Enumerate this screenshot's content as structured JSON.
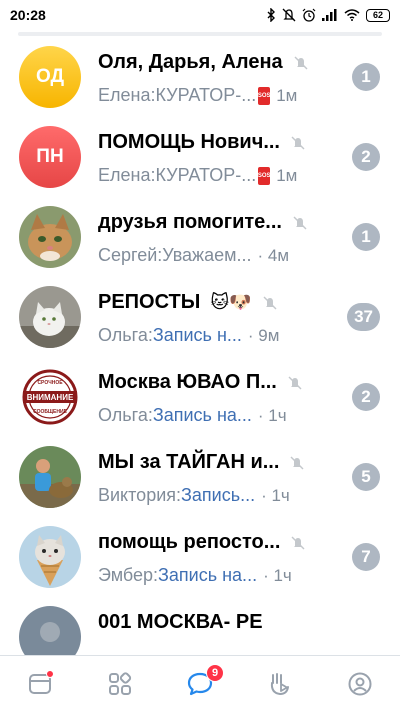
{
  "status_bar": {
    "time": "20:28",
    "battery": "62",
    "icons": [
      "bluetooth-icon",
      "mute-icon",
      "alarm-icon",
      "signal-icon",
      "wifi-icon",
      "battery-icon"
    ]
  },
  "chats": [
    {
      "avatar_initials": "ОД",
      "avatar_color": "#f7b500",
      "title": "Оля, Дарья, Алена",
      "sender": "Елена: ",
      "preview": "КУРАТОР-...",
      "preview_is_link": false,
      "has_sos": true,
      "time": "1м",
      "unread": "1",
      "muted": true
    },
    {
      "avatar_initials": "ПН",
      "avatar_color": "#e64646",
      "title": "ПОМОЩЬ Нович...",
      "sender": "Елена: ",
      "preview": "КУРАТОР-...",
      "preview_is_link": false,
      "has_sos": true,
      "time": "1м",
      "unread": "2",
      "muted": true
    },
    {
      "title": "друзья помогите...",
      "sender": "Сергей: ",
      "preview": "Уважаем...",
      "preview_is_link": false,
      "has_sos": false,
      "time": "· 4м",
      "unread": "1",
      "muted": true
    },
    {
      "title": "РЕПОСТЫ",
      "title_emoji": "🐱🐶",
      "sender": "Ольга: ",
      "preview": "Запись н...",
      "preview_is_link": true,
      "has_sos": false,
      "time": "· 9м",
      "unread": "37",
      "muted": true
    },
    {
      "title": "Москва ЮВАО П...",
      "avatar_text": [
        "СРОЧНОЕ",
        "ВНИМАНИЕ",
        "СООБЩЕНИЕ"
      ],
      "sender": "Ольга: ",
      "preview": "Запись на...",
      "preview_is_link": true,
      "has_sos": false,
      "time": "· 1ч",
      "unread": "2",
      "muted": true
    },
    {
      "title": "МЫ за ТАЙГАН и...",
      "sender": "Виктория: ",
      "preview": "Запись...",
      "preview_is_link": true,
      "has_sos": false,
      "time": "· 1ч",
      "unread": "5",
      "muted": true
    },
    {
      "title": "помощь репосто...",
      "sender": "Эмбер: ",
      "preview": "Запись на...",
      "preview_is_link": true,
      "has_sos": false,
      "time": "· 1ч",
      "unread": "7",
      "muted": true
    },
    {
      "title": "001 МОСКВА- РЕ"
    }
  ],
  "tabbar": {
    "items": [
      "news-icon",
      "services-icon",
      "messages-icon",
      "clips-icon",
      "profile-icon"
    ],
    "messages_badge": "9",
    "accent": "#2688eb",
    "inactive": "#99a2ad"
  }
}
